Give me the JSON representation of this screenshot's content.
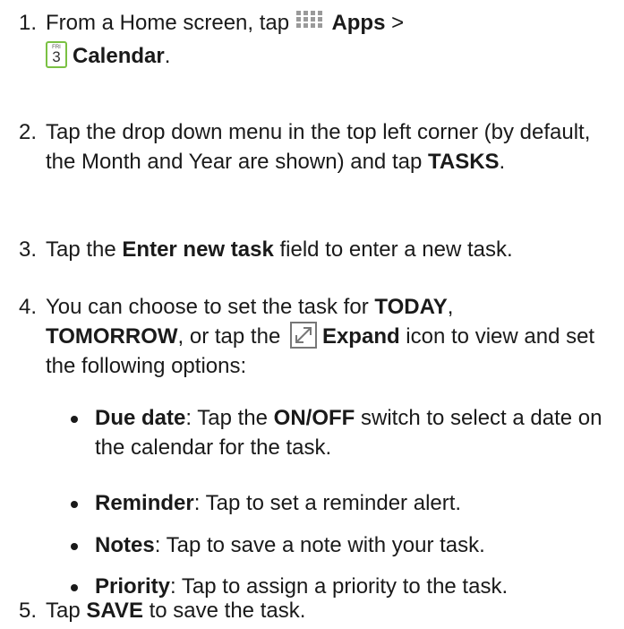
{
  "steps": [
    {
      "num": "1.",
      "line1_pre": "From a Home screen, tap ",
      "apps_icon": "apps-grid-icon",
      "line1_bold": "Apps",
      "line1_post": " >",
      "cal_icon": "calendar-icon",
      "cal_day": "FRI",
      "cal_date": "3",
      "line2_bold": "Calendar",
      "line2_post": "."
    },
    {
      "num": "2.",
      "text_pre": "Tap the drop down menu in the top left corner (by default, the Month and Year are shown) and tap ",
      "bold": "TASKS",
      "post": "."
    },
    {
      "num": "3.",
      "pre": "Tap the ",
      "bold": "Enter new task",
      "post": " field to enter a new task."
    },
    {
      "num": "4.",
      "pre": "You can choose to set the task for ",
      "bold1": "TODAY",
      "mid1": ",",
      "bold2": "TOMORROW",
      "mid2": ", or tap the ",
      "expand_icon": "expand-icon",
      "bold3": "Expand",
      "post": " icon to view and set the following options:",
      "options": [
        {
          "label": "Due date",
          "pre": ": Tap the ",
          "bold": "ON/OFF",
          "post": " switch to select a date on the calendar for the task."
        },
        {
          "label": "Reminder",
          "text": ": Tap to set a reminder alert."
        },
        {
          "label": "Notes",
          "text": ": Tap to save a note with your task."
        },
        {
          "label": "Priority",
          "text": ": Tap to assign a priority to the task."
        }
      ]
    },
    {
      "num": "5.",
      "pre": "Tap ",
      "bold": "SAVE",
      "post": " to save the task."
    }
  ],
  "colors": {
    "text": "#1a1a1a",
    "calendar_icon_border": "#7ac143",
    "apps_icon": "#9a9a9a",
    "expand_icon": "#777777"
  }
}
